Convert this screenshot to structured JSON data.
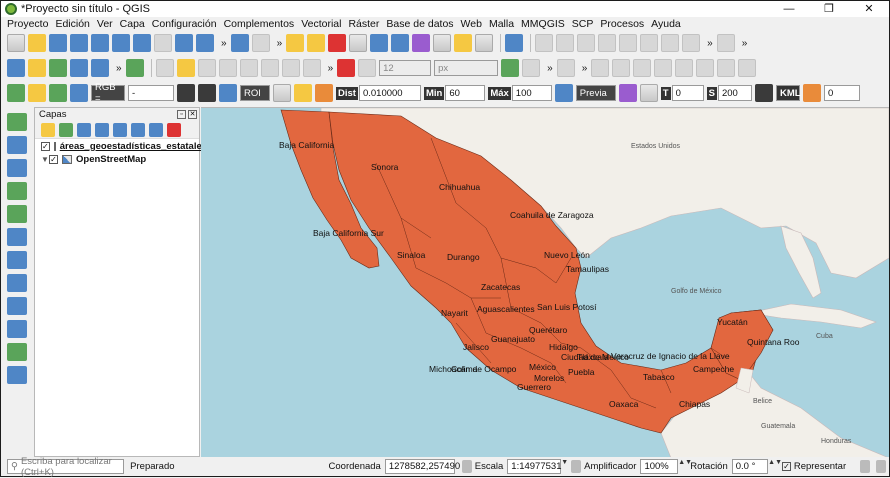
{
  "window": {
    "title": "*Proyecto sin título - QGIS",
    "min": "—",
    "max": "❐",
    "close": "✕"
  },
  "menu": [
    "Proyecto",
    "Edición",
    "Ver",
    "Capa",
    "Configuración",
    "Complementos",
    "Vectorial",
    "Ráster",
    "Base de datos",
    "Web",
    "Malla",
    "MMQGIS",
    "SCP",
    "Procesos",
    "Ayuda"
  ],
  "toolbar3": {
    "rgb": "RGB =",
    "dash": "-",
    "roi": "ROI",
    "dist_label": "Dist",
    "dist_value": "0.010000",
    "min_label": "Min",
    "min_value": "60",
    "max_label": "Máx",
    "max_value": "100",
    "previa": "Previa",
    "t_label": "T",
    "t_value": "0",
    "s_label": "S",
    "s_value": "200",
    "kml": "KML",
    "last_value": "0"
  },
  "toolbar2": {
    "size_value": "12",
    "unit": "px"
  },
  "layers_panel": {
    "title": "Capas",
    "layers": [
      {
        "name": "áreas_geoestadísticas_estatales",
        "checked": "✓",
        "color": "#e2673f"
      },
      {
        "name": "OpenStreetMap",
        "checked": "✓"
      }
    ]
  },
  "map": {
    "fill_color": "#e2673f",
    "states": [
      "Baja California",
      "Sonora",
      "Chihuahua",
      "Coahuila de Zaragoza",
      "Baja California Sur",
      "Sinaloa",
      "Durango",
      "Nuevo León",
      "Tamaulipas",
      "Zacatecas",
      "Nayarit",
      "Aguascalientes",
      "San Luis Potosí",
      "Querétaro",
      "Guanajuato",
      "Jalisco",
      "Hidalgo",
      "Veracruz de Ignacio de la Llave",
      "Tlaxcala",
      "Ciudad de México",
      "México",
      "Michoacán de Ocampo",
      "Colima",
      "Morelos",
      "Puebla",
      "Guerrero",
      "Oaxaca",
      "Tabasco",
      "Chiapas",
      "Campeche",
      "Yucatán",
      "Quintana Roo"
    ],
    "basemap_labels": [
      "Estados Unidos",
      "Golfo de México",
      "Cuba",
      "Guatemala",
      "Honduras",
      "Belice"
    ]
  },
  "statusbar": {
    "search_placeholder": "Escriba para localizar (Ctrl+K)",
    "status": "Preparado",
    "coord_label": "Coordenada",
    "coord_value": "1278582,257490",
    "scale_label": "Escala",
    "scale_value": "1:14977531",
    "magnifier_label": "Amplificador",
    "magnifier_value": "100%",
    "rotation_label": "Rotación",
    "rotation_value": "0.0 °",
    "render_label": "Representar",
    "render_checked": "✓"
  }
}
